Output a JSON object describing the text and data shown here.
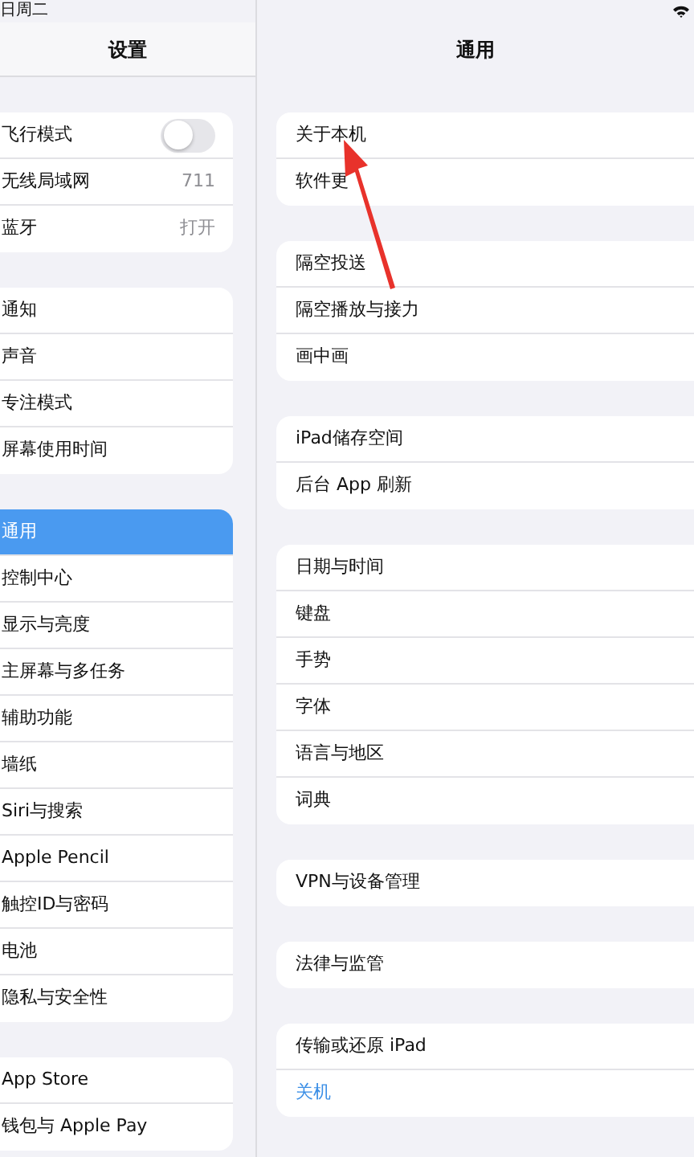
{
  "status_bar": {
    "date": "日周二"
  },
  "sidebar": {
    "title": "设置",
    "groups": [
      [
        {
          "label": "飞行模式",
          "kind": "toggle",
          "on": false,
          "selected": false
        },
        {
          "label": "无线局域网",
          "kind": "value",
          "value": "711",
          "selected": false
        },
        {
          "label": "蓝牙",
          "kind": "value",
          "value": "打开",
          "selected": false
        }
      ],
      [
        {
          "label": "通知",
          "kind": "link",
          "selected": false
        },
        {
          "label": "声音",
          "kind": "link",
          "selected": false
        },
        {
          "label": "专注模式",
          "kind": "link",
          "selected": false
        },
        {
          "label": "屏幕使用时间",
          "kind": "link",
          "selected": false
        }
      ],
      [
        {
          "label": "通用",
          "kind": "link",
          "selected": true
        },
        {
          "label": "控制中心",
          "kind": "link",
          "selected": false
        },
        {
          "label": "显示与亮度",
          "kind": "link",
          "selected": false
        },
        {
          "label": "主屏幕与多任务",
          "kind": "link",
          "selected": false
        },
        {
          "label": "辅助功能",
          "kind": "link",
          "selected": false
        },
        {
          "label": "墙纸",
          "kind": "link",
          "selected": false
        },
        {
          "label": "Siri与搜索",
          "kind": "link",
          "selected": false
        },
        {
          "label": "Apple Pencil",
          "kind": "link",
          "selected": false
        },
        {
          "label": "触控ID与密码",
          "kind": "link",
          "selected": false
        },
        {
          "label": "电池",
          "kind": "link",
          "selected": false
        },
        {
          "label": "隐私与安全性",
          "kind": "link",
          "selected": false
        }
      ],
      [
        {
          "label": "App Store",
          "kind": "link",
          "selected": false
        },
        {
          "label": "钱包与 Apple Pay",
          "kind": "link",
          "selected": false
        }
      ]
    ]
  },
  "detail": {
    "title": "通用",
    "groups": [
      [
        {
          "label": "关于本机",
          "kind": "link"
        },
        {
          "label": "软件更",
          "kind": "link"
        }
      ],
      [
        {
          "label": "隔空投送",
          "kind": "link"
        },
        {
          "label": "隔空播放与接力",
          "kind": "link"
        },
        {
          "label": "画中画",
          "kind": "link"
        }
      ],
      [
        {
          "label": "iPad储存空间",
          "kind": "link"
        },
        {
          "label": "后台 App 刷新",
          "kind": "link"
        }
      ],
      [
        {
          "label": "日期与时间",
          "kind": "link"
        },
        {
          "label": "键盘",
          "kind": "link"
        },
        {
          "label": "手势",
          "kind": "link"
        },
        {
          "label": "字体",
          "kind": "link"
        },
        {
          "label": "语言与地区",
          "kind": "link"
        },
        {
          "label": "词典",
          "kind": "link"
        }
      ],
      [
        {
          "label": "VPN与设备管理",
          "kind": "link"
        }
      ],
      [
        {
          "label": "法律与监管",
          "kind": "link"
        }
      ],
      [
        {
          "label": "传输或还原 iPad",
          "kind": "link"
        },
        {
          "label": "关机",
          "kind": "action"
        }
      ]
    ]
  }
}
